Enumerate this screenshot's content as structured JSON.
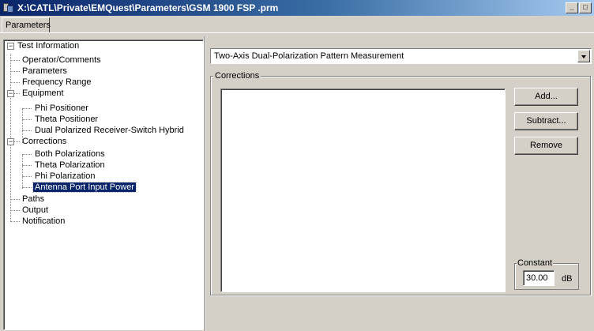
{
  "window": {
    "title": "X:\\CATL\\Private\\EMQuest\\Parameters\\GSM 1900 FSP .prm",
    "minimize_glyph": "_",
    "maximize_glyph": "□"
  },
  "tabs": [
    {
      "label": "Parameters"
    }
  ],
  "tree": {
    "root": {
      "label": "Test Information",
      "expander": "−"
    },
    "items": {
      "operator": "Operator/Comments",
      "parameters": "Parameters",
      "frequency": "Frequency Range",
      "equipment": "Equipment",
      "phi_positioner": "Phi Positioner",
      "theta_positioner": "Theta Positioner",
      "receiver": "Dual Polarized Receiver-Switch Hybrid",
      "corrections": "Corrections",
      "both_pol": "Both Polarizations",
      "theta_pol": "Theta Polarization",
      "phi_pol": "Phi Polarization",
      "antenna_power": "Antenna Port Input Power",
      "paths": "Paths",
      "output": "Output",
      "notification": "Notification"
    },
    "expander_minus": "−",
    "selected": "Antenna Port Input Power"
  },
  "measurement_select": {
    "value": "Two-Axis Dual-Polarization Pattern Measurement"
  },
  "corrections_group": {
    "title": "Corrections",
    "buttons": {
      "add": "Add...",
      "subtract": "Subtract...",
      "remove": "Remove"
    },
    "constant": {
      "title": "Constant",
      "value": "30.00",
      "unit": "dB"
    }
  },
  "colors": {
    "selection": "#0a246a",
    "titlebar_start": "#0a246a",
    "titlebar_end": "#a6caf0",
    "face": "#d4d0c8"
  }
}
